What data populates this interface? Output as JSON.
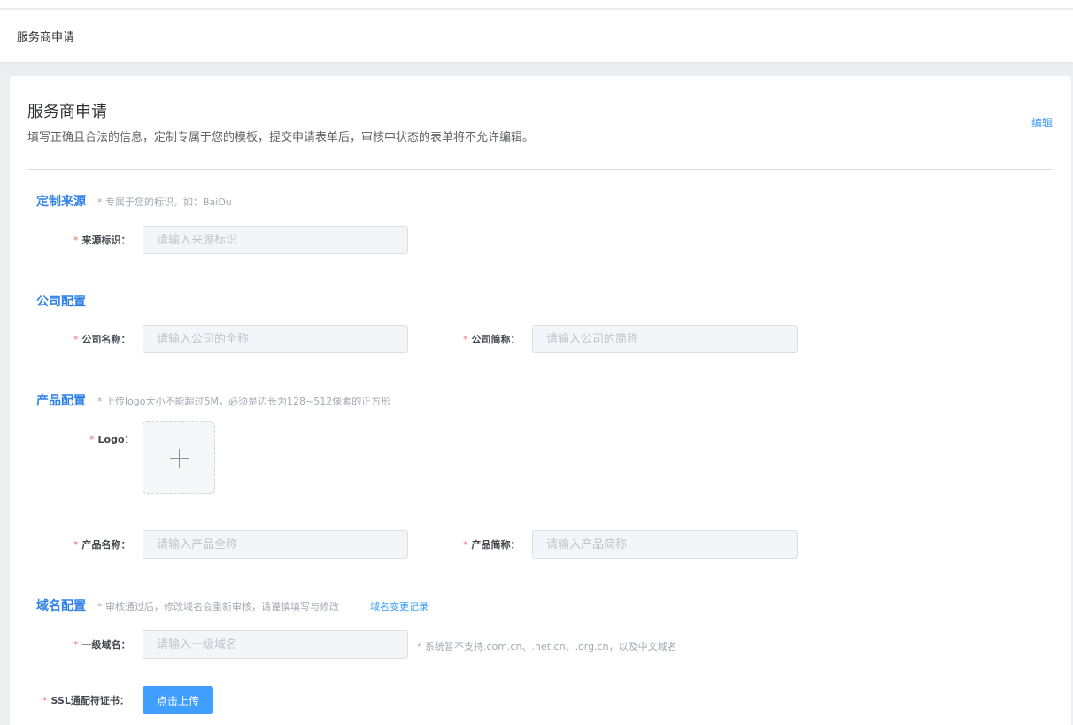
{
  "header": {
    "title": "服务商申请"
  },
  "card": {
    "title": "服务商申请",
    "description": "填写正确且合法的信息，定制专属于您的模板，提交申请表单后，审核中状态的表单将不允许编辑。",
    "edit_label": "编辑"
  },
  "sections": {
    "source": {
      "title": "定制来源",
      "hint": "* 专属于您的标识，如：BaiDu",
      "field_label": "来源标识：",
      "field_placeholder": "请输入来源标识",
      "field_value": ""
    },
    "company": {
      "title": "公司配置",
      "name_label": "公司名称：",
      "name_placeholder": "请输入公司的全称",
      "short_label": "公司简称：",
      "short_placeholder": "请输入公司的简称"
    },
    "product": {
      "title": "产品配置",
      "hint": "* 上传logo大小不能超过5M，必须是边长为128~512像素的正方形",
      "logo_label": "Logo：",
      "name_label": "产品名称：",
      "name_placeholder": "请输入产品全称",
      "short_label": "产品简称：",
      "short_placeholder": "请输入产品简称"
    },
    "domain": {
      "title": "域名配置",
      "hint": "* 审核通过后，修改域名会重新审核，请谨慎填写与修改",
      "history_link": "域名变更记录",
      "primary_label": "一级域名：",
      "primary_placeholder": "请输入一级域名",
      "primary_note": "* 系统暂不支持.com.cn、.net.cn、.org.cn，以及中文域名",
      "ssl_label": "SSL通配符证书：",
      "ssl_button": "点击上传"
    }
  },
  "required_mark": "*",
  "colors": {
    "accent": "#409eff",
    "section_title": "#2f80e7",
    "required": "#f56c6c",
    "background": "#eceef2"
  },
  "icons": {
    "upload": "plus-icon"
  }
}
